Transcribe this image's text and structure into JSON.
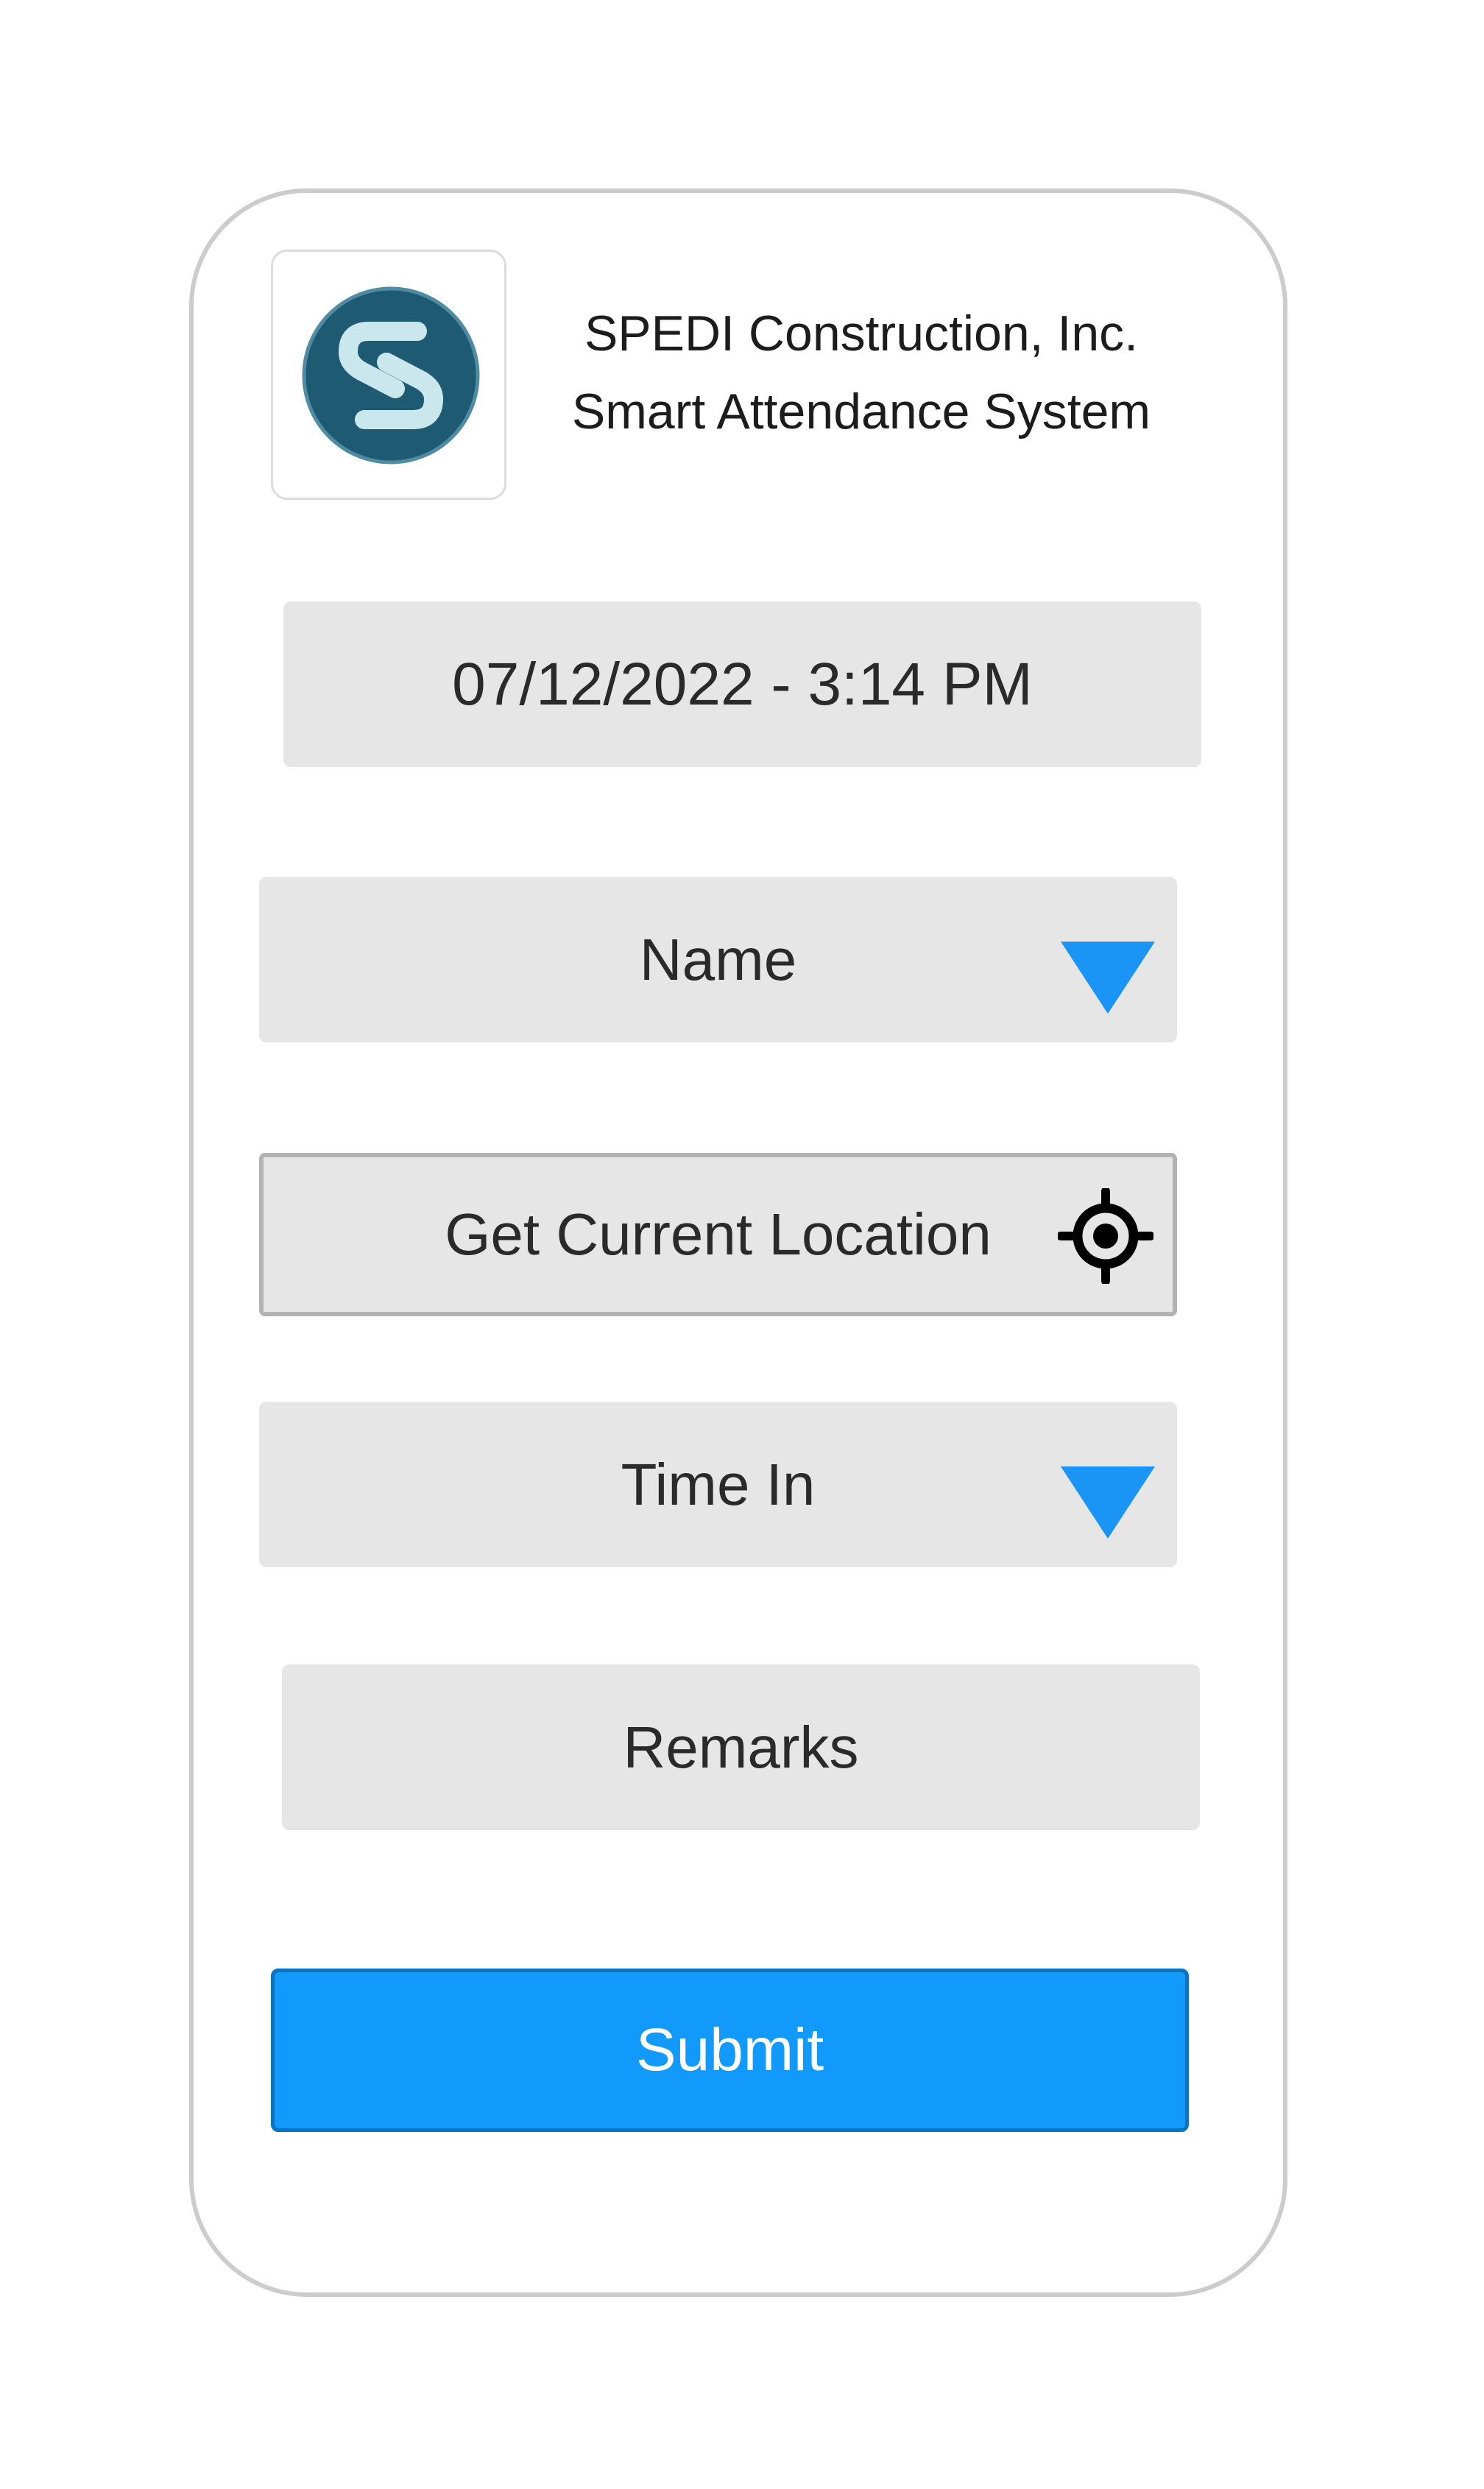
{
  "header": {
    "company_name": "SPEDI Construction, Inc.",
    "system_name": "Smart Attendance System",
    "logo_icon": "spedi-s-logo"
  },
  "form": {
    "datetime": "07/12/2022 - 3:14 PM",
    "name_select": {
      "label": "Name",
      "icon": "chevron-down-triangle"
    },
    "location_button": {
      "label": "Get Current Location",
      "icon": "crosshair-target"
    },
    "time_select": {
      "label": "Time In",
      "icon": "chevron-down-triangle"
    },
    "remarks": {
      "label": "Remarks"
    },
    "submit_label": "Submit"
  },
  "colors": {
    "accent": "#1199fb",
    "field_bg": "#e6e6e6",
    "logo_dark": "#1e5a71",
    "logo_light": "#cbe7ee"
  }
}
